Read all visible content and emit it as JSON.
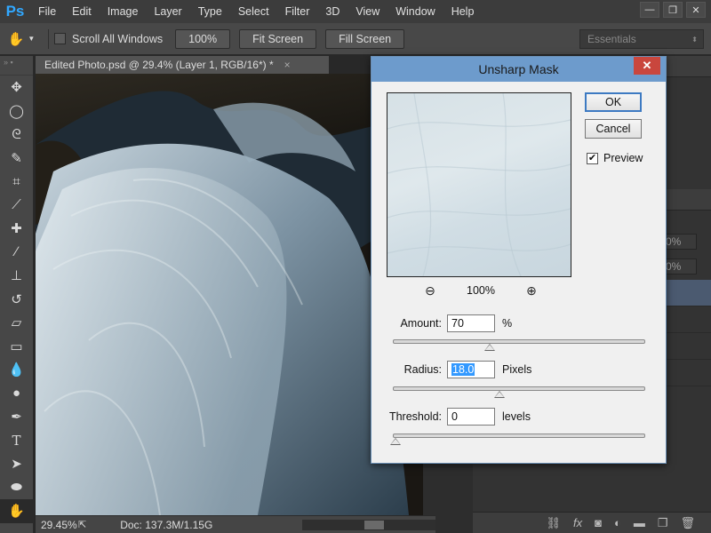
{
  "app": {
    "logo": "Ps"
  },
  "menu": [
    "File",
    "Edit",
    "Image",
    "Layer",
    "Type",
    "Select",
    "Filter",
    "3D",
    "View",
    "Window",
    "Help"
  ],
  "options_bar": {
    "scroll_all_windows": "Scroll All Windows",
    "zoom_100": "100%",
    "fit_screen": "Fit Screen",
    "fill_screen": "Fill Screen",
    "workspace": "Essentials"
  },
  "document": {
    "tab_title": "Edited Photo.psd @ 29.4% (Layer 1, RGB/16*) *",
    "tab_close": "×",
    "zoom": "29.45%",
    "doc_size": "Doc: 137.3M/1.15G"
  },
  "panels": {
    "opacity_a": "0%",
    "opacity_b": "0%"
  },
  "dialog": {
    "title": "Unsharp Mask",
    "close": "✕",
    "ok": "OK",
    "cancel": "Cancel",
    "preview_label": "Preview",
    "preview_checked": true,
    "preview_zoom": "100%",
    "amount_label": "Amount:",
    "amount_value": "70",
    "amount_unit": "%",
    "amount_fraction": 0.38,
    "radius_label": "Radius:",
    "radius_value": "18.0",
    "radius_unit": "Pixels",
    "radius_fraction": 0.42,
    "threshold_label": "Threshold:",
    "threshold_value": "0",
    "threshold_unit": "levels",
    "threshold_fraction": 0.0
  },
  "colors": {
    "accent": "#6d9bcc",
    "close": "#c9463d",
    "selected_layer": "#4b5a70"
  }
}
